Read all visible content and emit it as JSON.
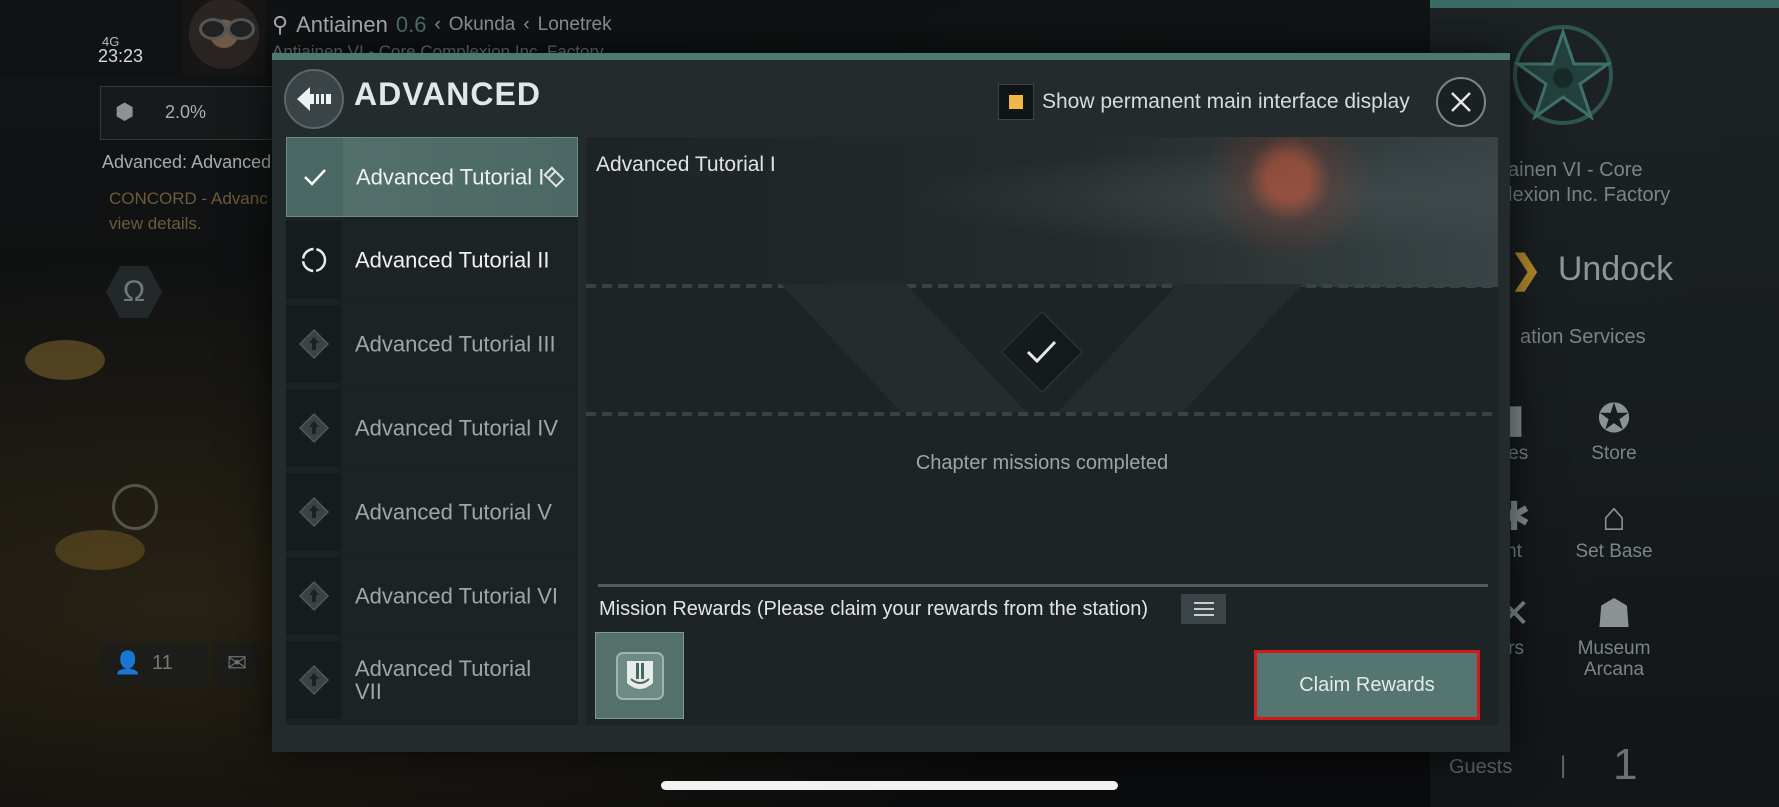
{
  "status_bar": {
    "network": "4G",
    "time": "23:23"
  },
  "location": {
    "system": "Antiainen",
    "security": "0.6",
    "constellation": "Okunda",
    "region": "Lonetrek",
    "station": "Antiainen VI - Core Complexion Inc. Factory"
  },
  "left_hud": {
    "progress": "2.0%",
    "mission_title": "Advanced: Advanced",
    "mission_desc_line1": "CONCORD - Advanc",
    "mission_desc_line2": "view details.",
    "omega_symbol": "Ω",
    "people_count": "11"
  },
  "right_panel": {
    "station_name_line1": "ainen VI - Core",
    "station_name_line2": "lexion Inc. Factory",
    "undock_label": "Undock",
    "station_services_label": "ation Services",
    "services": [
      {
        "label": "lies",
        "icon": "industry-icon"
      },
      {
        "label": "Store",
        "icon": "nes-store-icon"
      },
      {
        "label": "nt",
        "icon": "agent-icon"
      },
      {
        "label": "Set Base",
        "icon": "set-base-icon"
      },
      {
        "label": "irs",
        "icon": "repairs-icon"
      },
      {
        "label": "Museum Arcana",
        "icon": "museum-icon"
      }
    ],
    "guests_label": "Guests",
    "guests_separator": "|",
    "guests_count": "1"
  },
  "modal": {
    "title": "ADVANCED",
    "show_permanent_label": "Show permanent main interface display",
    "show_permanent_checked": true,
    "accent_color": "#4b7a73",
    "tutorials": [
      {
        "label": "Advanced Tutorial I",
        "state": "completed"
      },
      {
        "label": "Advanced Tutorial II",
        "state": "in-progress"
      },
      {
        "label": "Advanced Tutorial III",
        "state": "locked"
      },
      {
        "label": "Advanced Tutorial IV",
        "state": "locked"
      },
      {
        "label": "Advanced Tutorial V",
        "state": "locked"
      },
      {
        "label": "Advanced Tutorial VI",
        "state": "locked"
      },
      {
        "label": "Advanced Tutorial VII",
        "state": "locked"
      }
    ],
    "detail": {
      "title": "Advanced Tutorial I",
      "chapter_status": "Chapter missions completed",
      "rewards_label": "Mission Rewards (Please claim your rewards from the station)",
      "reward_icon": "skill-book-icon",
      "claim_button_label": "Claim Rewards",
      "claim_button_highlight": "#d11a1a"
    }
  }
}
